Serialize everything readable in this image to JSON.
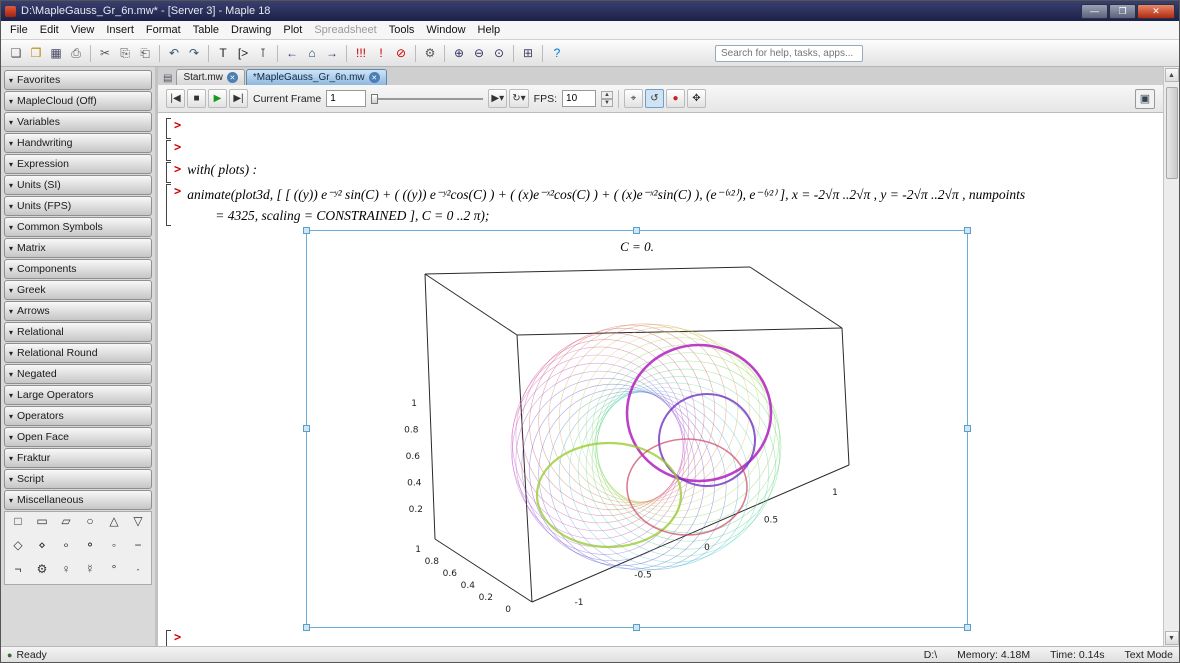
{
  "window": {
    "title": "D:\\MapleGauss_Gr_6n.mw* - [Server 3] - Maple 18"
  },
  "window_buttons": [
    {
      "name": "minimize-button",
      "glyph": "—"
    },
    {
      "name": "maximize-button",
      "glyph": "❐"
    },
    {
      "name": "close-button",
      "glyph": "✕",
      "close": true
    }
  ],
  "ui": {
    "palette_arrow": "▾",
    "close_glyph": "✕",
    "up": "▲",
    "down": "▼",
    "ready_icon": "●"
  },
  "menu": {
    "items": [
      {
        "label": "File"
      },
      {
        "label": "Edit"
      },
      {
        "label": "View"
      },
      {
        "label": "Insert"
      },
      {
        "label": "Format"
      },
      {
        "label": "Table"
      },
      {
        "label": "Drawing"
      },
      {
        "label": "Plot"
      },
      {
        "label": "Spreadsheet",
        "disabled": true
      },
      {
        "label": "Tools"
      },
      {
        "label": "Window"
      },
      {
        "label": "Help"
      }
    ]
  },
  "toolbar": {
    "search_placeholder": "Search for help, tasks, apps...",
    "icons": [
      {
        "name": "new-document-icon",
        "glyph": "❏",
        "color": "#555"
      },
      {
        "name": "open-file-icon",
        "glyph": "❒",
        "color": "#b8860b"
      },
      {
        "name": "save-icon",
        "glyph": "▦",
        "color": "#446"
      },
      {
        "name": "print-icon",
        "glyph": "⎙",
        "color": "#555"
      },
      {
        "sep": true
      },
      {
        "name": "cut-icon",
        "glyph": "✂",
        "color": "#555"
      },
      {
        "name": "copy-icon",
        "glyph": "⎘",
        "color": "#555"
      },
      {
        "name": "paste-icon",
        "glyph": "⎗",
        "color": "#555"
      },
      {
        "sep": true
      },
      {
        "name": "undo-icon",
        "glyph": "↶",
        "color": "#357"
      },
      {
        "name": "redo-icon",
        "glyph": "↷",
        "color": "#357"
      },
      {
        "sep": true
      },
      {
        "name": "insert-text-icon",
        "glyph": "T",
        "color": "#222"
      },
      {
        "name": "insert-math-icon",
        "glyph": "[>",
        "color": "#222"
      },
      {
        "name": "select-tool-icon",
        "glyph": "⊺",
        "color": "#222"
      },
      {
        "sep": true
      },
      {
        "name": "back-icon",
        "glyph": "←",
        "color": "#246"
      },
      {
        "name": "home-icon",
        "glyph": "⌂",
        "color": "#246"
      },
      {
        "name": "forward-icon",
        "glyph": "→",
        "color": "#246"
      },
      {
        "sep": true
      },
      {
        "name": "execute-all-icon",
        "glyph": "!!!",
        "color": "#c00"
      },
      {
        "name": "execute-icon",
        "glyph": "!",
        "color": "#c00"
      },
      {
        "name": "interrupt-icon",
        "glyph": "⊘",
        "color": "#c00"
      },
      {
        "sep": true
      },
      {
        "name": "debug-icon",
        "glyph": "⚙",
        "color": "#555"
      },
      {
        "sep": true
      },
      {
        "name": "zoom-in-icon",
        "glyph": "⊕",
        "color": "#336"
      },
      {
        "name": "zoom-out-icon",
        "glyph": "⊖",
        "color": "#336"
      },
      {
        "name": "zoom-reset-icon",
        "glyph": "⊙",
        "color": "#336"
      },
      {
        "sep": true
      },
      {
        "name": "insert-table-icon",
        "glyph": "⊞",
        "color": "#446"
      },
      {
        "sep": true
      },
      {
        "name": "help-icon",
        "glyph": "?",
        "color": "#07c"
      }
    ]
  },
  "tabs": [
    {
      "label": "Start.mw"
    },
    {
      "label": "*MapleGauss_Gr_6n.mw",
      "active": true
    }
  ],
  "animbar": {
    "transport": [
      {
        "name": "go-to-start-icon",
        "glyph": "|◀"
      },
      {
        "name": "stop-icon",
        "glyph": "■"
      },
      {
        "name": "play-icon",
        "glyph": "▶",
        "color": "#1a9a1a"
      },
      {
        "name": "go-to-end-icon",
        "glyph": "▶|"
      }
    ],
    "current_frame_label": "Current Frame",
    "frame_value": "1",
    "mode_buttons": [
      {
        "name": "play-direction-icon",
        "glyph": "▶▾"
      },
      {
        "name": "loop-mode-icon",
        "glyph": "↻▾"
      }
    ],
    "fps_label": "FPS:",
    "fps_value": "10",
    "view_buttons": [
      {
        "name": "probe-icon",
        "glyph": "⌖"
      },
      {
        "name": "rotate-icon",
        "glyph": "↺",
        "active": true
      },
      {
        "name": "scale-icon",
        "glyph": "●",
        "color": "#c22"
      },
      {
        "name": "pan-icon",
        "glyph": "✥"
      }
    ],
    "corner_glyph": "▣"
  },
  "sidebar": {
    "palettes": [
      {
        "label": "Favorites"
      },
      {
        "label": "MapleCloud (Off)"
      },
      {
        "label": "Variables"
      },
      {
        "label": "Handwriting"
      },
      {
        "label": "Expression"
      },
      {
        "label": "Units (SI)"
      },
      {
        "label": "Units (FPS)"
      },
      {
        "label": "Common Symbols"
      },
      {
        "label": "Matrix"
      },
      {
        "label": "Components"
      },
      {
        "label": "Greek"
      },
      {
        "label": "Arrows"
      },
      {
        "label": "Relational"
      },
      {
        "label": "Relational Round"
      },
      {
        "label": "Negated"
      },
      {
        "label": "Large Operators"
      },
      {
        "label": "Operators"
      },
      {
        "label": "Open Face"
      },
      {
        "label": "Fraktur"
      },
      {
        "label": "Script"
      },
      {
        "label": "Miscellaneous",
        "expanded": true
      }
    ],
    "misc_symbols": [
      "□",
      "▭",
      "▱",
      "○",
      "△",
      "▽",
      "◇",
      "⋄",
      "∘",
      "⚬",
      "◦",
      "−",
      "¬",
      "⚙",
      "♀",
      "☿",
      "°",
      "∙"
    ]
  },
  "worksheet": {
    "prompt": ">",
    "with_line": "with( plots) :",
    "animate_line1": "animate(plot3d, [ [ ((y)) e⁻ʸ² sin(C) + ( ((y)) e⁻ʸ²cos(C) ) + ( (x)e⁻ˣ²cos(C) ) + ( (x)e⁻ˣ²sin(C) ), (e⁻⁽ˣ²⁾), e⁻⁽ʸ²⁾ ], x = -2√π ..2√π , y = -2√π ..2√π , numpoints",
    "animate_line2": "= 4325, scaling = CONSTRAINED ], C = 0 ..2 π);"
  },
  "plot": {
    "title": "C = 0.",
    "axes": {
      "z_ticks": [
        "1",
        "0.8",
        "0.6",
        "0.4",
        "0.2"
      ],
      "y_ticks": [
        "1",
        "0.8",
        "0.6",
        "0.4",
        "0.2",
        "0"
      ],
      "x_ticks": [
        "-1",
        "-0.5",
        "0",
        "0.5",
        "1"
      ]
    }
  },
  "statusbar": {
    "ready": "Ready",
    "drive": "D:\\",
    "memory": "Memory: 4.18M",
    "time": "Time: 0.14s",
    "mode": "Text Mode"
  }
}
